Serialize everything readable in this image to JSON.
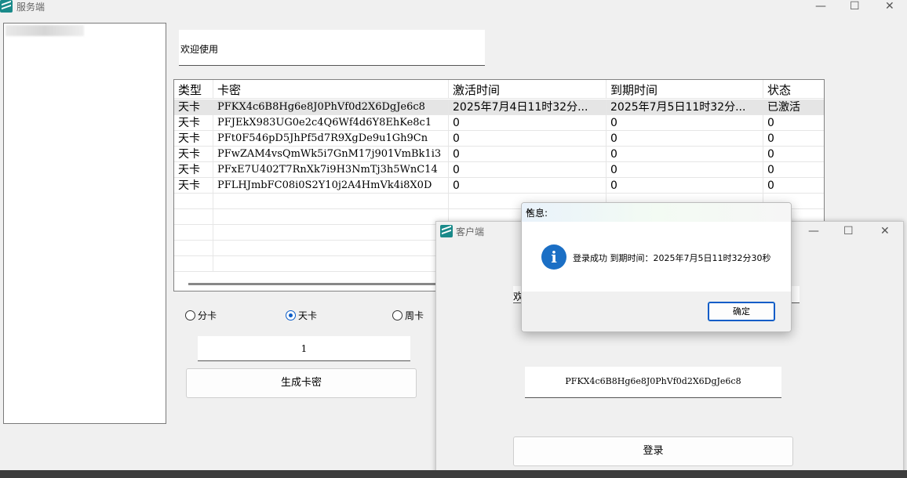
{
  "server": {
    "title": "服务端",
    "minimize": "—",
    "maximize": "☐",
    "close": "✕",
    "welcome": "欢迎使用",
    "grid": {
      "columns": [
        "类型",
        "卡密",
        "激活时间",
        "到期时间",
        "状态"
      ],
      "rows": [
        [
          "天卡",
          "PFKX4c6B8Hg6e8J0PhVf0d2X6DgJe6c8",
          "2025年7月4日11时32分...",
          "2025年7月5日11时32分...",
          "已激活"
        ],
        [
          "天卡",
          "PFJEkX983UG0e2c4Q6Wf4d6Y8EhKe8c1",
          "0",
          "0",
          "0"
        ],
        [
          "天卡",
          "PFt0F546pD5JhPf5d7R9XgDe9u1Gh9Cn",
          "0",
          "0",
          "0"
        ],
        [
          "天卡",
          "PFwZAM4vsQmWk5i7GnM17j901VmBk1i3",
          "0",
          "0",
          "0"
        ],
        [
          "天卡",
          "PFxE7U402T7RnXk7i9H3NmTj3h5WnC14",
          "0",
          "0",
          "0"
        ],
        [
          "天卡",
          "PFLHJmbFC08i0S2Y10j2A4HmVk4i8X0D",
          "0",
          "0",
          "0"
        ]
      ]
    },
    "radios": [
      {
        "label": "分卡",
        "checked": false
      },
      {
        "label": "天卡",
        "checked": true
      },
      {
        "label": "周卡",
        "checked": false
      }
    ],
    "count_value": "1",
    "generate_label": "生成卡密"
  },
  "client": {
    "title": "客户端",
    "minimize": "—",
    "maximize": "☐",
    "close": "✕",
    "welcome_partial": "欢",
    "card_value": "PFKX4c6B8Hg6e8J0PhVf0d2X6DgJe6c8",
    "login_label": "登录"
  },
  "message_box": {
    "title": "信息:",
    "close": "✕",
    "icon_glyph": "i",
    "text": "登录成功 到期时间：2025年7月5日11时32分30秒",
    "ok_label": "确定"
  },
  "colors": {
    "accent": "#0a5cc7",
    "info_icon": "#1b6fc5",
    "app_icon": "#1a8a8a"
  }
}
